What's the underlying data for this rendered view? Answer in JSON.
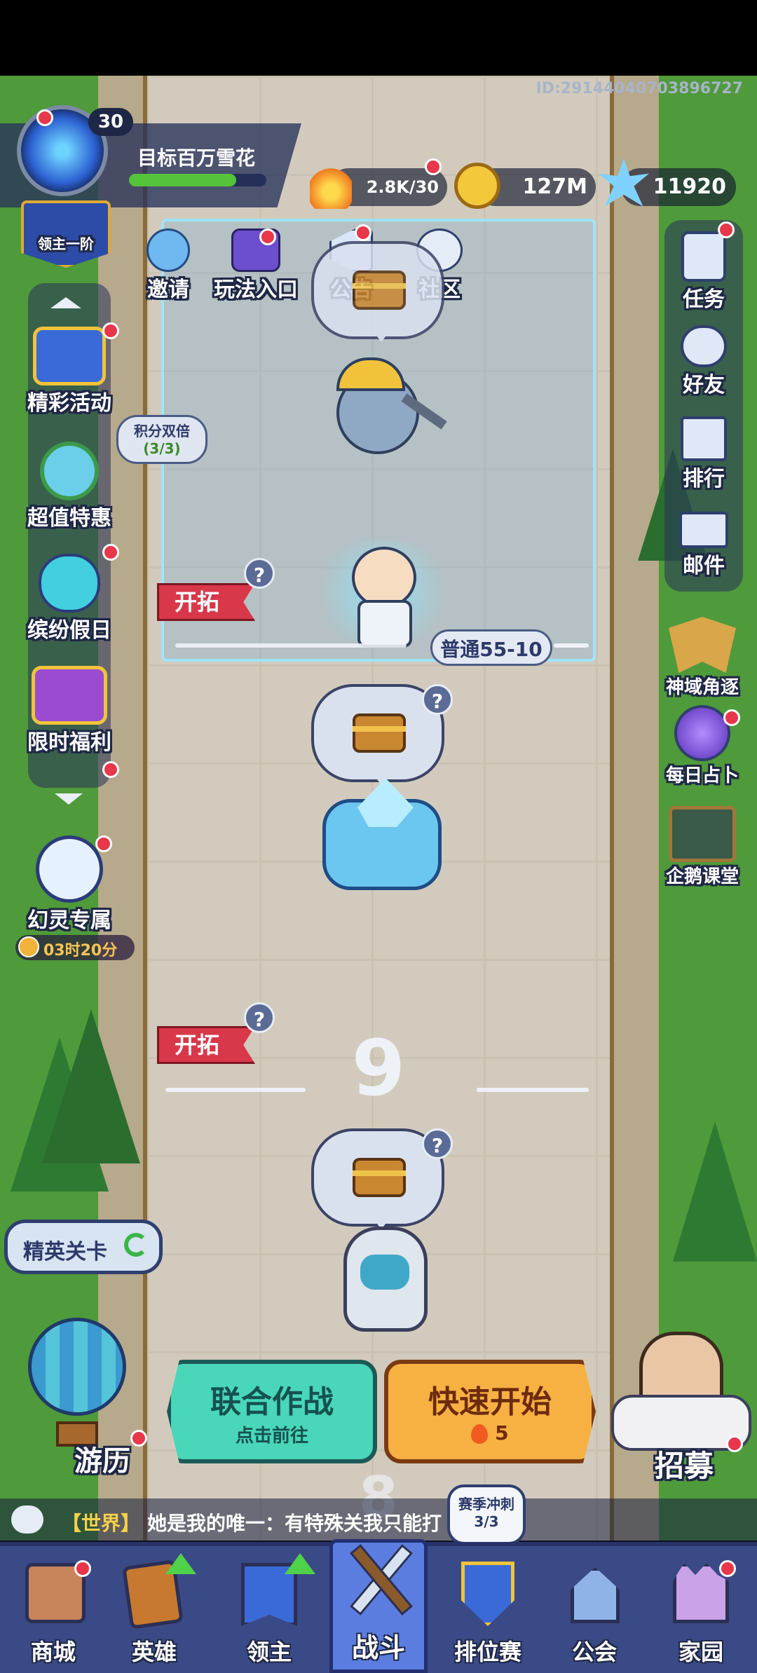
{
  "player": {
    "level": "30",
    "title": "目标百万雪花",
    "rank_badge": "领主一阶",
    "id_text": "ID:29144040703896727"
  },
  "resources": {
    "stamina": "2.8K/30",
    "gold": "127M",
    "gems": "11920"
  },
  "top_shortcuts": [
    {
      "label": "邀请",
      "icon": "penguin-invite-icon"
    },
    {
      "label": "玩法入口",
      "icon": "gamepad-icon"
    },
    {
      "label": "公告",
      "icon": "megaphone-icon"
    },
    {
      "label": "社区",
      "icon": "community-icon"
    }
  ],
  "left_menu": [
    {
      "label": "精彩活动",
      "icon": "chest-event-icon"
    },
    {
      "label": "超值特惠",
      "icon": "clock-deal-icon"
    },
    {
      "label": "缤纷假日",
      "icon": "holiday-character-icon"
    },
    {
      "label": "限时福利",
      "icon": "treasure-welfare-icon"
    },
    {
      "label": "幻灵专属",
      "icon": "spirit-icon"
    }
  ],
  "double_points": {
    "line1": "积分双倍",
    "line2": "(3/3)"
  },
  "spirit_timer": "03时20分",
  "right_menu": [
    {
      "label": "任务",
      "icon": "clipboard-icon"
    },
    {
      "label": "好友",
      "icon": "friends-icon"
    },
    {
      "label": "排行",
      "icon": "podium-icon"
    },
    {
      "label": "邮件",
      "icon": "mail-icon"
    },
    {
      "label": "神域角逐",
      "icon": "wings-crest-icon"
    },
    {
      "label": "每日占卜",
      "icon": "crystal-ball-icon"
    },
    {
      "label": "企鹅课堂",
      "icon": "penguin-class-icon"
    }
  ],
  "stage": {
    "explore_label": "开拓",
    "current_stage": "普通55-10",
    "floor_number": "9",
    "next_floor_number": "8"
  },
  "elite_button": "精英关卡",
  "travel_label": "游历",
  "recruit_label": "招募",
  "buttons": {
    "coop_title": "联合作战",
    "coop_sub": "点击前往",
    "quick_title": "快速开始",
    "quick_cost": "5"
  },
  "chat": {
    "channel": "【世界】",
    "message": "她是我的唯一：有特殊关我只能打"
  },
  "season_badge": {
    "line1": "赛季冲刺",
    "line2": "3/3"
  },
  "bottom_nav": [
    {
      "label": "商城",
      "icon": "shop-icon"
    },
    {
      "label": "英雄",
      "icon": "hero-card-icon"
    },
    {
      "label": "领主",
      "icon": "lord-banner-icon"
    },
    {
      "label": "战斗",
      "icon": "battle-weapons-icon"
    },
    {
      "label": "排位赛",
      "icon": "ranked-shield-icon"
    },
    {
      "label": "公会",
      "icon": "guild-castle-icon"
    },
    {
      "label": "家园",
      "icon": "home-castle-icon"
    }
  ],
  "colors": {
    "path": "#d2cbbd",
    "grass": "#4f9a3a",
    "nav_bg": "#3a4a86",
    "active_tab": "#5b7de0",
    "coop_green": "#49d6b9",
    "quick_orange": "#f6b142"
  }
}
